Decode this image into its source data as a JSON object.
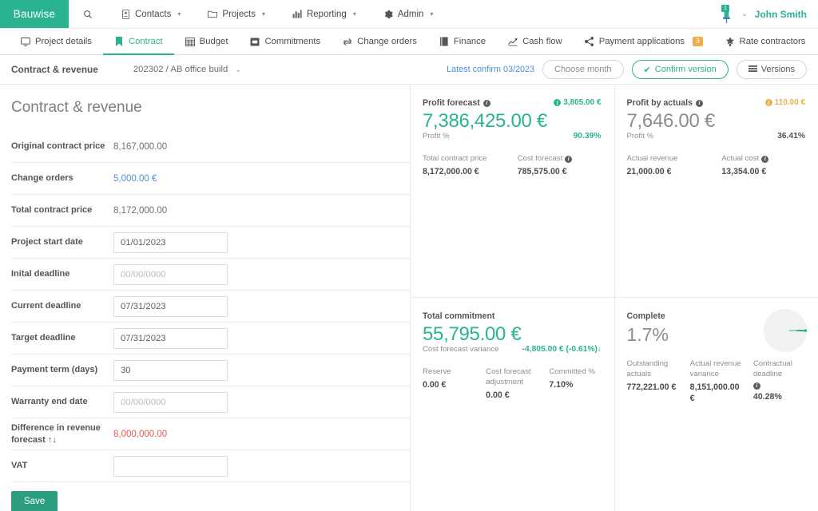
{
  "navbar": {
    "brand": "Bauwise",
    "search_icon": "search-icon",
    "items": [
      {
        "label": "Contacts",
        "icon": "contacts-book-icon",
        "caret": "▾"
      },
      {
        "label": "Projects",
        "icon": "folder-icon",
        "caret": "▾"
      },
      {
        "label": "Reporting",
        "icon": "bar-chart-icon",
        "caret": "▾"
      },
      {
        "label": "Admin",
        "icon": "gear-icon",
        "caret": "▾"
      }
    ],
    "pin_icon": "pushpin-icon",
    "pin_badge": "1",
    "user_caret": "⌄",
    "user_name": "John Smith"
  },
  "tabs": [
    {
      "label": "Project details",
      "icon": "monitor-icon",
      "active": false,
      "badge": ""
    },
    {
      "label": "Contract",
      "icon": "bookmark-icon",
      "active": true,
      "badge": ""
    },
    {
      "label": "Budget",
      "icon": "table-grid-icon",
      "active": false,
      "badge": ""
    },
    {
      "label": "Commitments",
      "icon": "archive-box-icon",
      "active": false,
      "badge": ""
    },
    {
      "label": "Change orders",
      "icon": "exchange-arrows-icon",
      "active": false,
      "badge": ""
    },
    {
      "label": "Finance",
      "icon": "book-icon",
      "active": false,
      "badge": ""
    },
    {
      "label": "Cash flow",
      "icon": "line-chart-icon",
      "active": false,
      "badge": ""
    },
    {
      "label": "Payment applications",
      "icon": "share-nodes-icon",
      "active": false,
      "badge": "3"
    },
    {
      "label": "Rate contractors",
      "icon": "star-badge-icon",
      "active": false,
      "badge": ""
    }
  ],
  "subheader": {
    "title": "Contract & revenue",
    "contract_value": "202302 / AB office buildi",
    "contract_caret": "⌄",
    "latest_confirm": "Latest confirm 03/2023",
    "choose_month_placeholder": "Choose month",
    "confirm_version_label": "Confirm version",
    "confirm_check": "✔",
    "versions_label": "Versions"
  },
  "form": {
    "page_title": "Contract & revenue",
    "rows": [
      {
        "label": "Original contract price",
        "type": "text",
        "value": "8,167,000.00",
        "style": "plain"
      },
      {
        "label": "Change orders",
        "type": "text",
        "value": "5,000.00 €",
        "style": "link"
      },
      {
        "label": "Total contract price",
        "type": "text",
        "value": "8,172,000.00",
        "style": "plain"
      },
      {
        "label": "Project start date",
        "type": "input",
        "value": "01/01/2023",
        "style": "plain"
      },
      {
        "label": "Inital deadline",
        "type": "input",
        "value": "00/00/0000",
        "style": "empty"
      },
      {
        "label": "Current deadline",
        "type": "input",
        "value": "07/31/2023",
        "style": "plain"
      },
      {
        "label": "Target deadline",
        "type": "input",
        "value": "07/31/2023",
        "style": "plain"
      },
      {
        "label": "Payment term (days)",
        "type": "input",
        "value": "30",
        "style": "plain"
      },
      {
        "label": "Warranty end date",
        "type": "input",
        "value": "00/00/0000",
        "style": "empty"
      },
      {
        "label": "Difference in revenue forecast ↑↓",
        "type": "text",
        "value": "8,000,000.00",
        "style": "danger"
      },
      {
        "label": "VAT",
        "type": "input",
        "value": "",
        "style": "plain"
      }
    ],
    "save_label": "Save"
  },
  "cards": {
    "profit_forecast": {
      "title": "Profit forecast",
      "flag_value": "3,805.00 €",
      "amount": "7,386,425.00 €",
      "sub_label": "Profit %",
      "sub_value": "90.39%",
      "metrics": [
        {
          "label": "Total contract price",
          "value": "8,172,000.00 €",
          "info": false
        },
        {
          "label": "Cost forecast",
          "value": "785,575.00 €",
          "info": true
        }
      ]
    },
    "profit_by_actuals": {
      "title": "Profit by actuals",
      "flag_value": "110.00 €",
      "amount": "7,646.00 €",
      "sub_label": "Profit %",
      "sub_value": "36.41%",
      "metrics": [
        {
          "label": "Actual revenue",
          "value": "21,000.00 €",
          "info": false
        },
        {
          "label": "Actual cost",
          "value": "13,354.00 €",
          "info": true
        }
      ]
    },
    "total_commitment": {
      "title": "Total commitment",
      "amount": "55,795.00 €",
      "sub_label": "Cost forecast variance",
      "sub_value": "-4,805.00 € (-0.61%)",
      "sub_arrow": "↓",
      "metrics": [
        {
          "label": "Reserve",
          "value": "0.00 €",
          "info": false
        },
        {
          "label": "Cost forecast adjustment",
          "value": "0.00 €",
          "info": false
        },
        {
          "label": "Committed %",
          "value": "7.10%",
          "info": false
        }
      ]
    },
    "complete": {
      "title": "Complete",
      "amount": "1.7%",
      "metrics": [
        {
          "label": "Outstanding actuals",
          "value": "772,221.00 €",
          "info": false
        },
        {
          "label": "Actual revenue variance",
          "value": "8,151,000.00 €",
          "info": false
        },
        {
          "label": "Contractual deadline",
          "value": "40.28%",
          "info": true
        }
      ]
    }
  },
  "chart_data": {
    "type": "pie",
    "title": "Complete",
    "categories": [
      "Complete",
      "Remaining"
    ],
    "values": [
      1.7,
      98.3
    ],
    "colors": [
      "#2ab391",
      "#f1f1f1"
    ],
    "legend": false
  },
  "colors": {
    "brand_teal": "#2ab391",
    "accent_orange": "#f0ad4e",
    "link_blue": "#4a90d9",
    "danger_red": "#f0554b"
  }
}
